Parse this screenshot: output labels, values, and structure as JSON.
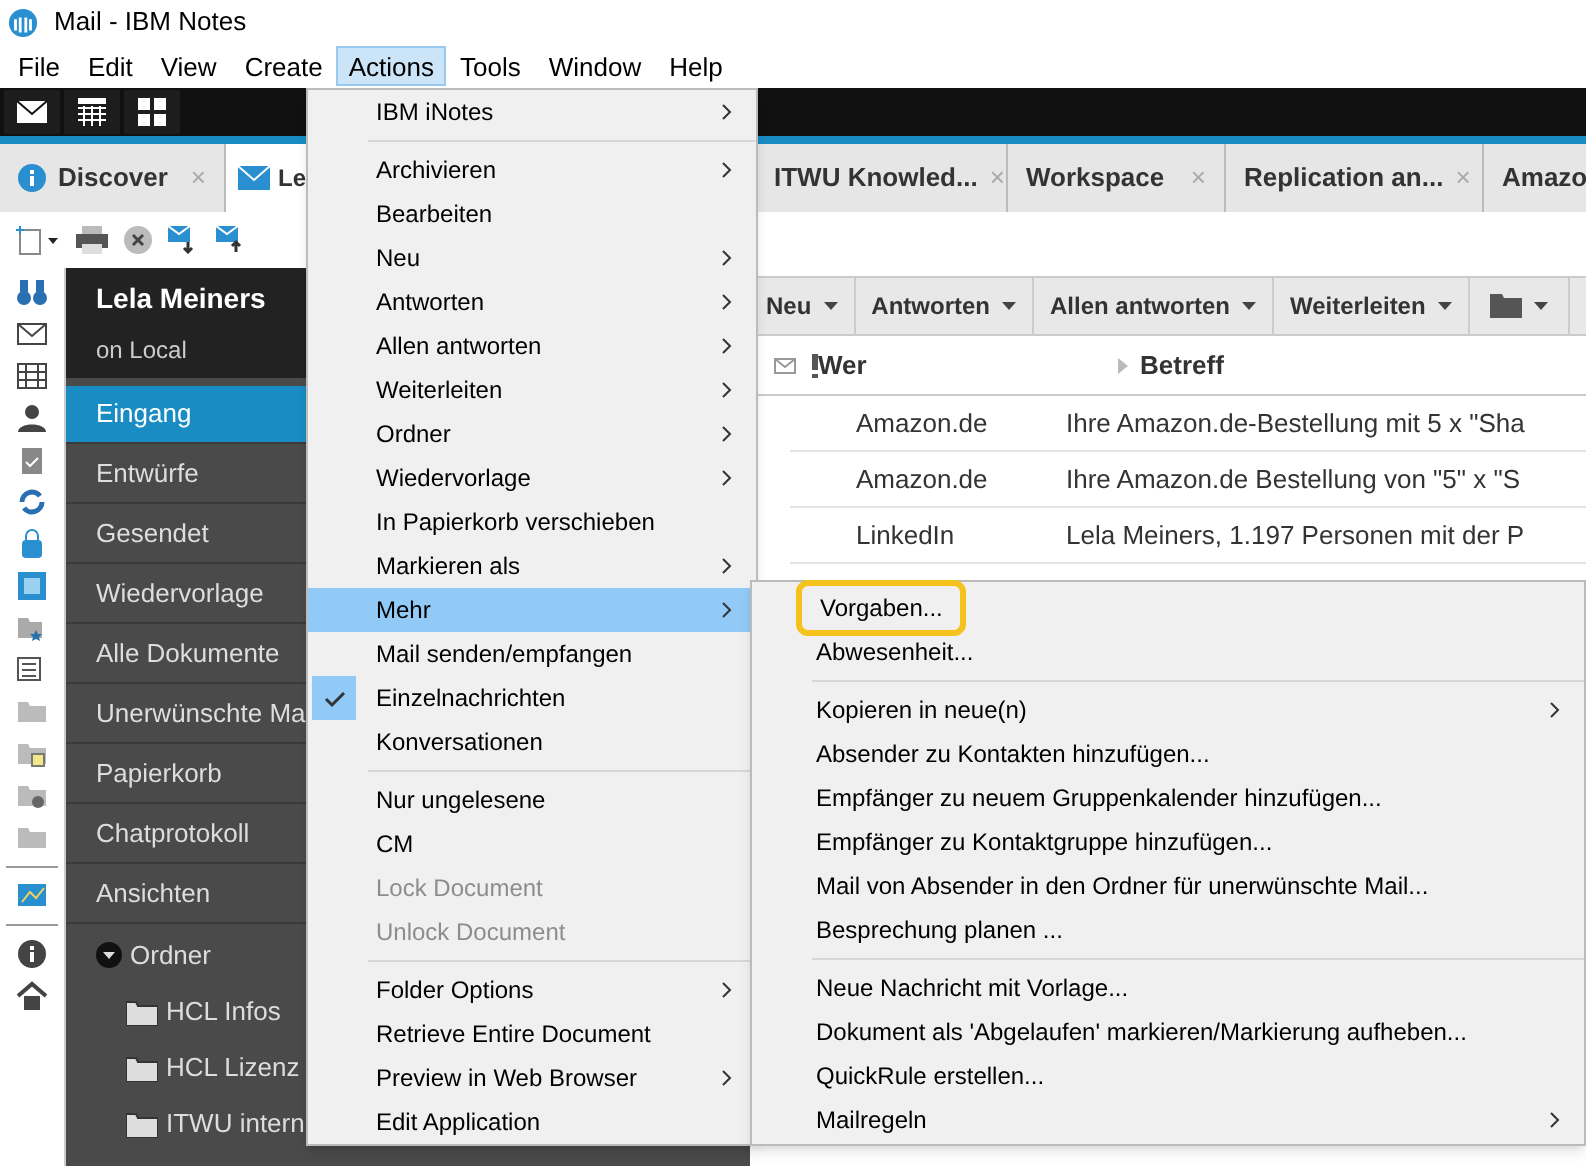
{
  "window": {
    "title": "Mail - IBM Notes"
  },
  "menu_bar": [
    {
      "label": "File",
      "selected": false
    },
    {
      "label": "Edit",
      "selected": false
    },
    {
      "label": "View",
      "selected": false
    },
    {
      "label": "Create",
      "selected": false
    },
    {
      "label": "Actions",
      "selected": true
    },
    {
      "label": "Tools",
      "selected": false
    },
    {
      "label": "Window",
      "selected": false
    },
    {
      "label": "Help",
      "selected": false
    }
  ],
  "tabs": [
    {
      "label": "Discover",
      "selected": false,
      "close": "×"
    },
    {
      "label": "Le",
      "selected": true
    },
    {
      "label": "ITWU Knowled...",
      "selected": false,
      "close": "×"
    },
    {
      "label": "Workspace",
      "selected": false,
      "close": "×"
    },
    {
      "label": "Replication an...",
      "selected": false,
      "close": "×"
    },
    {
      "label": "Amazo",
      "selected": false
    }
  ],
  "sidebar": {
    "owner": "Lela Meiners",
    "location": "on Local",
    "items": [
      {
        "label": "Eingang",
        "selected": true
      },
      {
        "label": "Entwürfe",
        "selected": false
      },
      {
        "label": "Gesendet",
        "selected": false
      },
      {
        "label": "Wiedervorlage",
        "selected": false
      },
      {
        "label": "Alle Dokumente",
        "selected": false
      },
      {
        "label": "Unerwünschte Ma",
        "selected": false
      },
      {
        "label": "Papierkorb",
        "selected": false
      },
      {
        "label": "Chatprotokoll",
        "selected": false
      },
      {
        "label": "Ansichten",
        "selected": false
      }
    ],
    "folders": {
      "label": "Ordner",
      "expanded": true,
      "children": [
        {
          "label": "HCL Infos"
        },
        {
          "label": "HCL Lizenz"
        },
        {
          "label": "ITWU intern"
        }
      ]
    }
  },
  "mail_toolbar": [
    "Neu",
    "Antworten",
    "Allen antworten",
    "Weiterleiten"
  ],
  "columns": [
    {
      "label": "Wer"
    },
    {
      "label": "Betreff"
    }
  ],
  "rows": [
    {
      "who": "Amazon.de",
      "subject": "Ihre Amazon.de-Bestellung mit 5 x \"Sha"
    },
    {
      "who": "Amazon.de",
      "subject": "Ihre Amazon.de Bestellung von \"5\" x \"S"
    },
    {
      "who": "LinkedIn",
      "subject": "Lela Meiners, 1.197 Personen mit der P"
    }
  ],
  "actions_menu": [
    {
      "kind": "item",
      "label": "IBM iNotes",
      "submenu": true
    },
    {
      "kind": "separator"
    },
    {
      "kind": "item",
      "label": "Archivieren",
      "submenu": true
    },
    {
      "kind": "item",
      "label": "Bearbeiten",
      "submenu": false
    },
    {
      "kind": "item",
      "label": "Neu",
      "submenu": true
    },
    {
      "kind": "item",
      "label": "Antworten",
      "submenu": true
    },
    {
      "kind": "item",
      "label": "Allen antworten",
      "submenu": true
    },
    {
      "kind": "item",
      "label": "Weiterleiten",
      "submenu": true
    },
    {
      "kind": "item",
      "label": "Ordner",
      "submenu": true
    },
    {
      "kind": "item",
      "label": "Wiedervorlage",
      "submenu": true
    },
    {
      "kind": "item",
      "label": "In Papierkorb verschieben",
      "submenu": false
    },
    {
      "kind": "item",
      "label": "Markieren als",
      "submenu": true
    },
    {
      "kind": "item",
      "label": "Mehr",
      "submenu": true,
      "selected": true
    },
    {
      "kind": "item",
      "label": "Mail senden/empfangen",
      "submenu": false
    },
    {
      "kind": "item",
      "label": "Einzelnachrichten",
      "submenu": false,
      "checked": true
    },
    {
      "kind": "item",
      "label": "Konversationen",
      "submenu": false,
      "checked": false
    },
    {
      "kind": "separator"
    },
    {
      "kind": "item",
      "label": "Nur ungelesene",
      "submenu": false
    },
    {
      "kind": "item",
      "label": "CM",
      "submenu": false
    },
    {
      "kind": "item",
      "label": "Lock Document",
      "submenu": false,
      "disabled": true
    },
    {
      "kind": "item",
      "label": "Unlock Document",
      "submenu": false,
      "disabled": true
    },
    {
      "kind": "separator"
    },
    {
      "kind": "item",
      "label": "Folder Options",
      "submenu": true
    },
    {
      "kind": "item",
      "label": "Retrieve Entire Document",
      "submenu": false
    },
    {
      "kind": "item",
      "label": "Preview in Web Browser",
      "submenu": true
    },
    {
      "kind": "item",
      "label": "Edit Application",
      "submenu": false
    }
  ],
  "more_submenu": [
    {
      "kind": "item",
      "label": "Vorgaben...",
      "submenu": false,
      "highlighted": true
    },
    {
      "kind": "item",
      "label": "Abwesenheit...",
      "submenu": false
    },
    {
      "kind": "separator"
    },
    {
      "kind": "item",
      "label": "Kopieren in neue(n)",
      "submenu": true
    },
    {
      "kind": "item",
      "label": "Absender zu Kontakten hinzufügen...",
      "submenu": false
    },
    {
      "kind": "item",
      "label": "Empfänger zu neuem Gruppenkalender hinzufügen...",
      "submenu": false
    },
    {
      "kind": "item",
      "label": "Empfänger zu Kontaktgruppe hinzufügen...",
      "submenu": false
    },
    {
      "kind": "item",
      "label": "Mail von Absender in den Ordner für unerwünschte Mail...",
      "submenu": false
    },
    {
      "kind": "item",
      "label": "Besprechung planen ...",
      "submenu": false
    },
    {
      "kind": "separator"
    },
    {
      "kind": "item",
      "label": "Neue Nachricht mit Vorlage...",
      "submenu": false
    },
    {
      "kind": "item",
      "label": "Dokument als 'Abgelaufen' markieren/Markierung aufheben...",
      "submenu": false
    },
    {
      "kind": "item",
      "label": "QuickRule erstellen...",
      "submenu": false
    },
    {
      "kind": "item",
      "label": "Mailregeln",
      "submenu": true
    }
  ]
}
